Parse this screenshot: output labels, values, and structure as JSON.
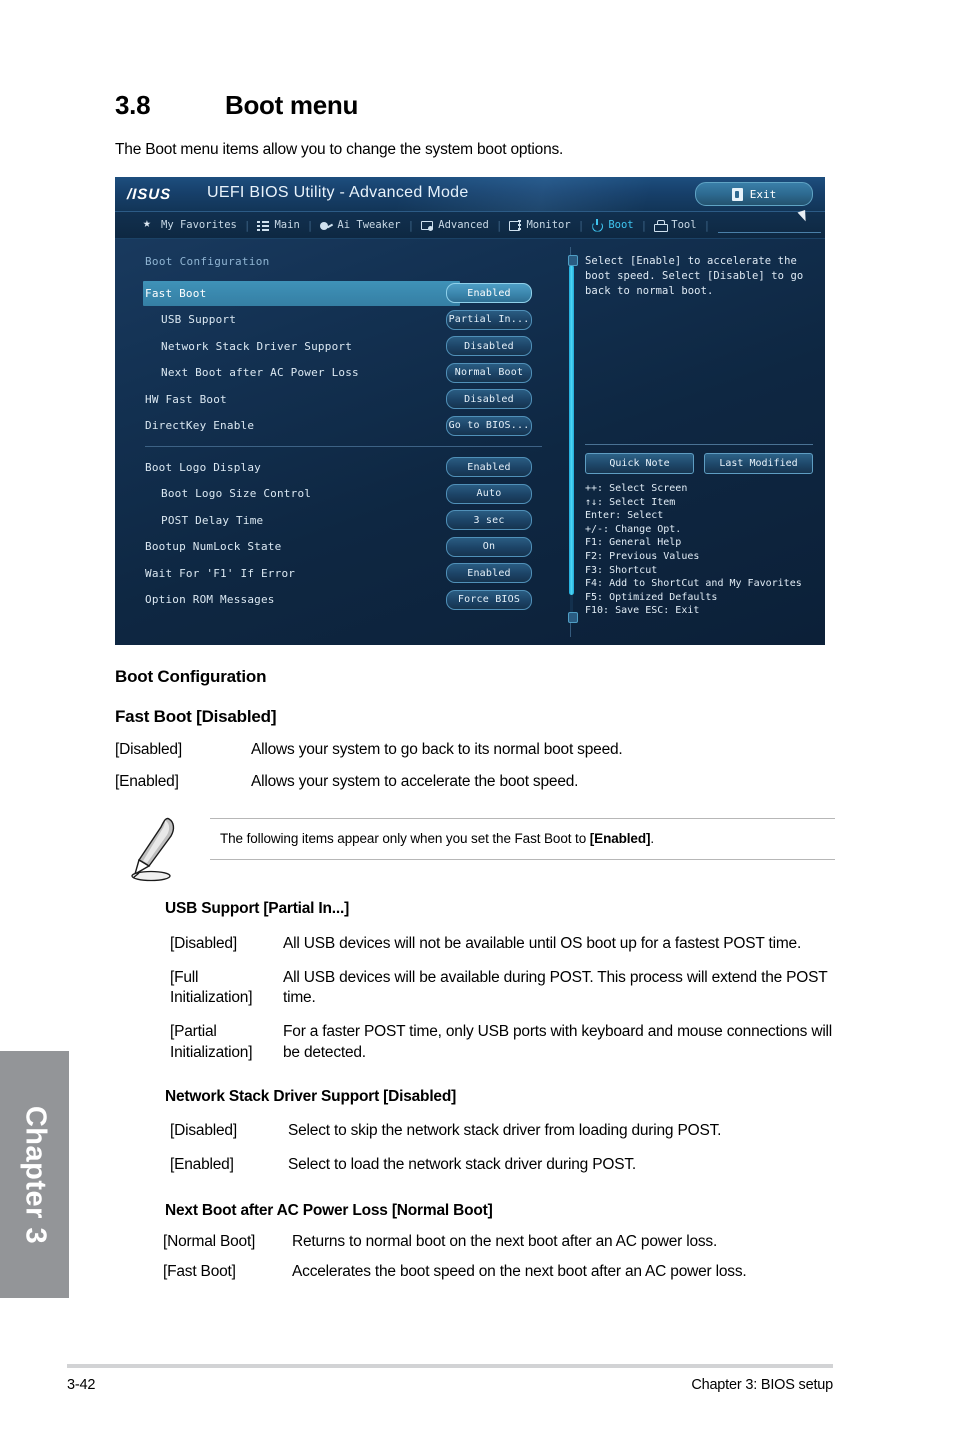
{
  "chapter_tab": {
    "label": "Chapter 3"
  },
  "section": {
    "number": "3.8",
    "title": "Boot menu",
    "intro": "The Boot menu items allow you to change the system boot options."
  },
  "bios": {
    "brand": "/ISUS",
    "title": "UEFI BIOS Utility - Advanced Mode",
    "exit_label": "Exit",
    "tabs": [
      {
        "label": "My Favorites",
        "icon": "star-icon",
        "active": false
      },
      {
        "label": "Main",
        "icon": "list-icon",
        "active": false
      },
      {
        "label": "Ai Tweaker",
        "icon": "tweaker-icon",
        "active": false
      },
      {
        "label": "Advanced",
        "icon": "advanced-icon",
        "active": false
      },
      {
        "label": "Monitor",
        "icon": "monitor-icon",
        "active": false
      },
      {
        "label": "Boot",
        "icon": "power-icon",
        "active": true
      },
      {
        "label": "Tool",
        "icon": "tool-icon",
        "active": false
      }
    ],
    "panel_title": "Boot Configuration",
    "items": [
      {
        "label": "Fast Boot",
        "value": "Enabled",
        "indent": 0,
        "selected": true
      },
      {
        "label": "USB Support",
        "value": "Partial In...",
        "indent": 1,
        "selected": false
      },
      {
        "label": "Network Stack Driver Support",
        "value": "Disabled",
        "indent": 1,
        "selected": false
      },
      {
        "label": "Next Boot after AC Power Loss",
        "value": "Normal Boot",
        "indent": 1,
        "selected": false
      },
      {
        "label": "HW Fast Boot",
        "value": "Disabled",
        "indent": 0,
        "selected": false
      },
      {
        "label": "DirectKey Enable",
        "value": "Go to BIOS...",
        "indent": 0,
        "selected": false
      }
    ],
    "items2": [
      {
        "label": "Boot Logo Display",
        "value": "Enabled",
        "indent": 0,
        "selected": false
      },
      {
        "label": "Boot Logo Size Control",
        "value": "Auto",
        "indent": 1,
        "selected": false
      },
      {
        "label": "POST Delay Time",
        "value": "3 sec",
        "indent": 1,
        "selected": false
      },
      {
        "label": "Bootup NumLock State",
        "value": "On",
        "indent": 0,
        "selected": false
      },
      {
        "label": "Wait For 'F1' If Error",
        "value": "Enabled",
        "indent": 0,
        "selected": false
      },
      {
        "label": "Option ROM Messages",
        "value": "Force BIOS",
        "indent": 0,
        "selected": false
      }
    ],
    "help_text": "Select [Enable] to accelerate the boot speed. Select [Disable] to go back to normal boot.",
    "help_buttons": {
      "quick_note": "Quick Note",
      "last_modified": "Last Modified"
    },
    "key_legend": "++: Select Screen\n↑↓: Select Item\nEnter: Select\n+/-: Change Opt.\nF1: General Help\nF2: Previous Values\nF3: Shortcut\nF4: Add to ShortCut and My Favorites\nF5: Optimized Defaults\nF10: Save  ESC: Exit"
  },
  "doc": {
    "boot_config_heading": "Boot Configuration",
    "fast_boot": {
      "heading": "Fast Boot [Disabled]",
      "rows": [
        {
          "term": "[Disabled]",
          "desc": "Allows your system to go back to its normal boot speed."
        },
        {
          "term": "[Enabled]",
          "desc": "Allows your system to accelerate the boot speed."
        }
      ]
    },
    "note": {
      "text_before": "The following items appear only when you set the Fast Boot to ",
      "text_bold": "[Enabled]",
      "text_after": "."
    },
    "usb_support": {
      "heading": "USB Support [Partial In...]",
      "rows": [
        {
          "term": "[Disabled]",
          "desc": "All USB devices will not be available until OS boot up for a fastest POST time."
        },
        {
          "term": "[Full Initialization]",
          "desc": "All USB devices will be available during POST. This process will extend the POST time."
        },
        {
          "term": "[Partial Initialization]",
          "desc": "For a faster POST time, only USB ports with keyboard and mouse connections will be detected."
        }
      ]
    },
    "network_stack": {
      "heading": "Network Stack Driver Support [Disabled]",
      "rows": [
        {
          "term": "[Disabled]",
          "desc": "Select to skip the network stack driver from loading during POST."
        },
        {
          "term": "[Enabled]",
          "desc": "Select to load the network stack driver during POST."
        }
      ]
    },
    "next_boot": {
      "heading": "Next Boot after AC Power Loss [Normal Boot]",
      "rows": [
        {
          "term": "[Normal Boot]",
          "desc": "Returns to normal boot on the next boot after an AC power loss."
        },
        {
          "term": "[Fast Boot]",
          "desc": "Accelerates the boot speed on the next boot after an AC power loss."
        }
      ]
    }
  },
  "footer": {
    "page_number": "3-42",
    "chapter_label": "Chapter 3: BIOS setup"
  }
}
